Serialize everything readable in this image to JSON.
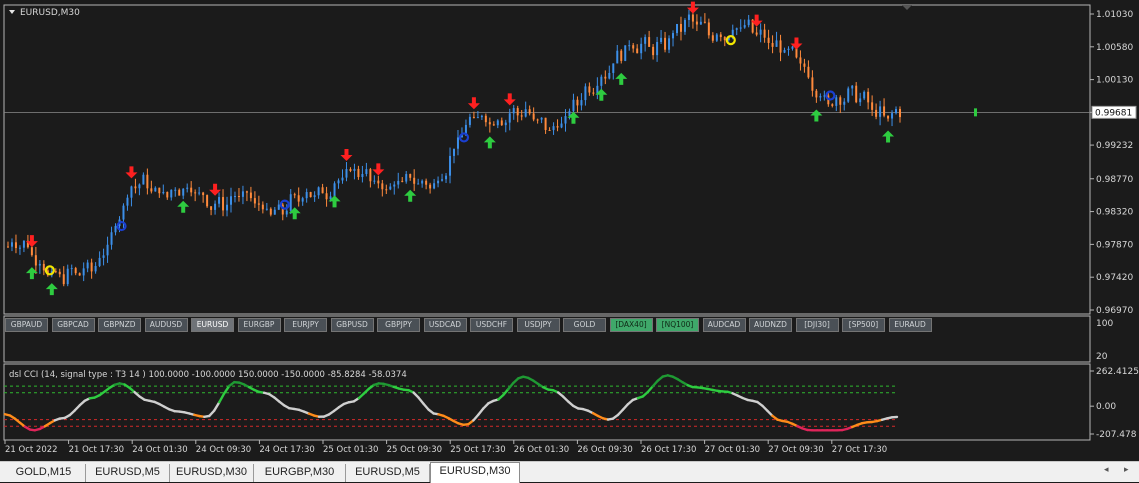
{
  "window": {
    "title": "EURUSD,M30"
  },
  "price_axis": {
    "labels": [
      "1.01030",
      "1.00580",
      "1.00130",
      "0.99681",
      "0.99232",
      "0.98770",
      "0.98320",
      "0.97870",
      "0.97420",
      "0.96970"
    ],
    "current": "0.99681"
  },
  "symbols": [
    {
      "label": "GBPAUD",
      "state": "normal"
    },
    {
      "label": "GBPCAD",
      "state": "normal"
    },
    {
      "label": "GBPNZD",
      "state": "normal"
    },
    {
      "label": "AUDUSD",
      "state": "normal"
    },
    {
      "label": "EURUSD",
      "state": "active"
    },
    {
      "label": "EURGBP",
      "state": "normal"
    },
    {
      "label": "EURJPY",
      "state": "normal"
    },
    {
      "label": "GBPUSD",
      "state": "normal"
    },
    {
      "label": "GBPJPY",
      "state": "normal"
    },
    {
      "label": "USDCAD",
      "state": "normal"
    },
    {
      "label": "USDCHF",
      "state": "normal"
    },
    {
      "label": "USDJPY",
      "state": "normal"
    },
    {
      "label": "GOLD",
      "state": "normal"
    },
    {
      "label": "[DAX40]",
      "state": "green"
    },
    {
      "label": "[NQ100]",
      "state": "green"
    },
    {
      "label": "AUDCAD",
      "state": "normal"
    },
    {
      "label": "AUDNZD",
      "state": "normal"
    },
    {
      "label": "[DJI30]",
      "state": "normal"
    },
    {
      "label": "[SP500]",
      "state": "normal"
    },
    {
      "label": "EURAUD",
      "state": "normal"
    }
  ],
  "middle_axis": {
    "top": "100",
    "bottom": "20"
  },
  "indicator": {
    "label": "dsl CCI  (14, signal type : T3  14 ) 100.0000 -100.0000 150.0000 -150.0000 -85.8284 -58.0374",
    "axis_labels": [
      "262.4125",
      "0.00",
      "-207.478"
    ]
  },
  "time_axis": [
    "21 Oct 2022",
    "21 Oct 17:30",
    "24 Oct 01:30",
    "24 Oct 09:30",
    "24 Oct 17:30",
    "25 Oct 01:30",
    "25 Oct 09:30",
    "25 Oct 17:30",
    "26 Oct 01:30",
    "26 Oct 09:30",
    "26 Oct 17:30",
    "27 Oct 01:30",
    "27 Oct 09:30",
    "27 Oct 17:30"
  ],
  "tabs": [
    {
      "label": "GOLD,M15",
      "active": false
    },
    {
      "label": "EURUSD,M5",
      "active": false
    },
    {
      "label": "EURUSD,M30",
      "active": false
    },
    {
      "label": "EURGBP,M30",
      "active": false
    },
    {
      "label": "EURUSD,M5",
      "active": false
    },
    {
      "label": "EURUSD,M30",
      "active": true
    }
  ],
  "colors": {
    "bull": "#3c8fe8",
    "bear": "#ff8a3c",
    "arrow_up": "#2ecc40",
    "arrow_down": "#ff2020",
    "cci_green": "#2ecc40",
    "cci_dark_green": "#1f9a33",
    "cci_gray": "#cfcfcf",
    "cci_orange": "#ff8c1a",
    "cci_red": "#e0245a"
  },
  "chart_data": {
    "type": "candlestick",
    "x": [
      "21 Oct 2022",
      "21 Oct 17:30",
      "24 Oct 01:30",
      "24 Oct 09:30",
      "24 Oct 17:30",
      "25 Oct 01:30",
      "25 Oct 09:30",
      "25 Oct 17:30",
      "26 Oct 01:30",
      "26 Oct 09:30",
      "26 Oct 17:30",
      "27 Oct 01:30",
      "27 Oct 09:30",
      "27 Oct 17:30"
    ],
    "close": [
      0.9784,
      0.974,
      0.9868,
      0.985,
      0.9838,
      0.988,
      0.9867,
      0.9965,
      0.9955,
      1.005,
      1.0085,
      1.0075,
      0.999,
      0.9968
    ],
    "ylim": [
      0.9697,
      1.0103
    ],
    "current_price": 0.99681,
    "indicator": {
      "name": "dsl CCI",
      "levels": [
        150,
        100,
        -100,
        -150
      ],
      "ylim": [
        -207.478,
        262.4125
      ],
      "values": [
        -60,
        -180,
        -90,
        60,
        170,
        40,
        -40,
        -80,
        180,
        100,
        -20,
        -80,
        30,
        170,
        120,
        -60,
        -140,
        40,
        220,
        120,
        -20,
        -100,
        60,
        230,
        140,
        110,
        40,
        -110,
        -180,
        -180,
        -120,
        -80
      ]
    }
  }
}
